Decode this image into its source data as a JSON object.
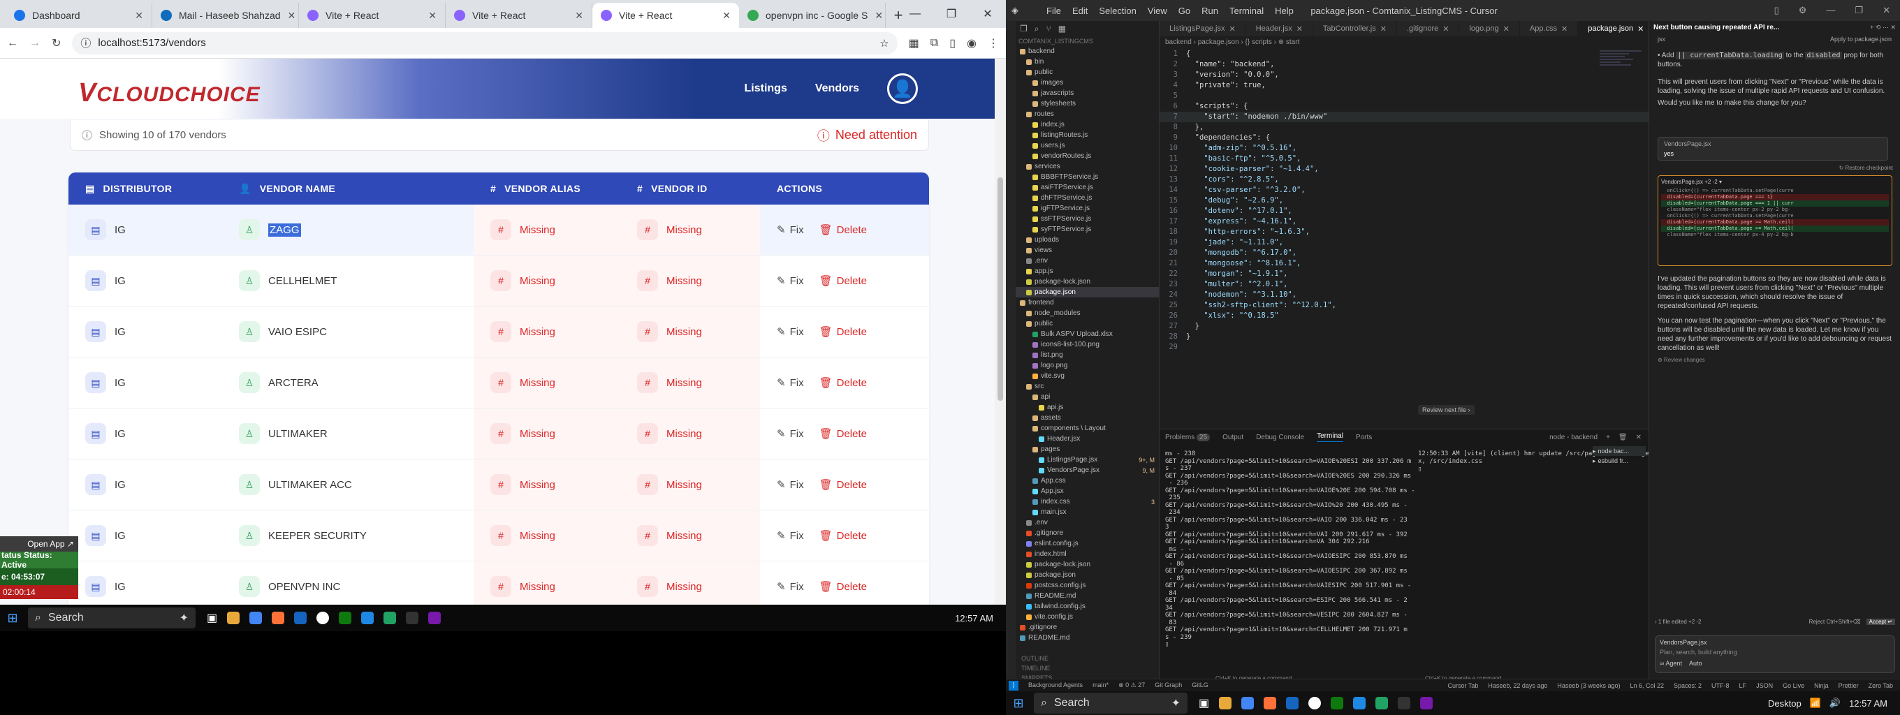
{
  "browser": {
    "tabs": [
      {
        "label": "Dashboard",
        "color": "#1a73e8"
      },
      {
        "label": "Mail - Haseeb Shahzad",
        "color": "#0f6cbd"
      },
      {
        "label": "Vite + React",
        "color": "#8a63ff"
      },
      {
        "label": "Vite + React",
        "color": "#8a63ff"
      },
      {
        "label": "Vite + React",
        "color": "#8a63ff",
        "active": true
      },
      {
        "label": "openvpn inc - Google S",
        "color": "#34a853"
      }
    ],
    "url": "localhost:5173/vendors"
  },
  "app": {
    "logo_v": "V",
    "logo_text": "CLOUDCHOICE",
    "nav": [
      "Listings",
      "Vendors"
    ],
    "summary": "Showing 10 of 170 vendors",
    "attention": "Need attention",
    "columns": [
      "DISTRIBUTOR",
      "VENDOR NAME",
      "VENDOR ALIAS",
      "VENDOR ID",
      "ACTIONS"
    ],
    "fix_label": "Fix",
    "delete_label": "Delete",
    "rows": [
      {
        "distributor": "IG",
        "name": "ZAGG",
        "alias": "Missing",
        "id": "Missing"
      },
      {
        "distributor": "IG",
        "name": "CELLHELMET",
        "alias": "Missing",
        "id": "Missing"
      },
      {
        "distributor": "IG",
        "name": "VAIO ESIPC",
        "alias": "Missing",
        "id": "Missing"
      },
      {
        "distributor": "IG",
        "name": "ARCTERA",
        "alias": "Missing",
        "id": "Missing"
      },
      {
        "distributor": "IG",
        "name": "ULTIMAKER",
        "alias": "Missing",
        "id": "Missing"
      },
      {
        "distributor": "IG",
        "name": "ULTIMAKER ACC",
        "alias": "Missing",
        "id": "Missing"
      },
      {
        "distributor": "IG",
        "name": "KEEPER SECURITY",
        "alias": "Missing",
        "id": "Missing"
      },
      {
        "distributor": "IG",
        "name": "OPENVPN INC",
        "alias": "Missing",
        "id": "Missing"
      }
    ]
  },
  "widget": {
    "open": "Open App ↗",
    "status": "tatus Status: Active",
    "time": "e: 04:53:07",
    "extra": "02:00:14"
  },
  "taskbar_left": {
    "search": "Search",
    "time": "12:57 AM"
  },
  "taskbar_right": {
    "search": "Search",
    "desktop": "Desktop",
    "time": "12:57 AM"
  },
  "vscode": {
    "menu": [
      "File",
      "Edit",
      "Selection",
      "View",
      "Go",
      "Run",
      "Terminal",
      "Help"
    ],
    "title": "package.json - Comtanix_ListingCMS - Cursor",
    "tabs": [
      "ListingsPage.jsx",
      "Header.jsx",
      "TabController.js",
      ".gitignore",
      "logo.png",
      "App.css",
      "package.json"
    ],
    "crumbs": "backend  ›  package.json  ›  {} scripts  ›  ⊕ start",
    "explorer_title": "COMTANIX_LISTINGCMS",
    "files": [
      {
        "name": "backend",
        "d": 0,
        "c": "#dcb67a"
      },
      {
        "name": "bin",
        "d": 1,
        "c": "#dcb67a"
      },
      {
        "name": "public",
        "d": 1,
        "c": "#dcb67a"
      },
      {
        "name": "images",
        "d": 2,
        "c": "#dcb67a"
      },
      {
        "name": "javascripts",
        "d": 2,
        "c": "#dcb67a"
      },
      {
        "name": "stylesheets",
        "d": 2,
        "c": "#dcb67a"
      },
      {
        "name": "routes",
        "d": 1,
        "c": "#dcb67a"
      },
      {
        "name": "index.js",
        "d": 2,
        "c": "#e8d44d"
      },
      {
        "name": "listingRoutes.js",
        "d": 2,
        "c": "#e8d44d"
      },
      {
        "name": "users.js",
        "d": 2,
        "c": "#e8d44d"
      },
      {
        "name": "vendorRoutes.js",
        "d": 2,
        "c": "#e8d44d"
      },
      {
        "name": "services",
        "d": 1,
        "c": "#dcb67a"
      },
      {
        "name": "BBBFTPService.js",
        "d": 2,
        "c": "#e8d44d"
      },
      {
        "name": "asiFTPService.js",
        "d": 2,
        "c": "#e8d44d"
      },
      {
        "name": "dhFTPService.js",
        "d": 2,
        "c": "#e8d44d"
      },
      {
        "name": "igFTPService.js",
        "d": 2,
        "c": "#e8d44d"
      },
      {
        "name": "ssFTPService.js",
        "d": 2,
        "c": "#e8d44d"
      },
      {
        "name": "syFTPService.js",
        "d": 2,
        "c": "#e8d44d"
      },
      {
        "name": "uploads",
        "d": 1,
        "c": "#dcb67a"
      },
      {
        "name": "views",
        "d": 1,
        "c": "#dcb67a"
      },
      {
        "name": ".env",
        "d": 1,
        "c": "#888"
      },
      {
        "name": "app.js",
        "d": 1,
        "c": "#e8d44d"
      },
      {
        "name": "package-lock.json",
        "d": 1,
        "c": "#cbcb41"
      },
      {
        "name": "package.json",
        "d": 1,
        "c": "#cbcb41",
        "sel": true
      },
      {
        "name": "frontend",
        "d": 0,
        "c": "#dcb67a"
      },
      {
        "name": "node_modules",
        "d": 1,
        "c": "#dcb67a"
      },
      {
        "name": "public",
        "d": 1,
        "c": "#dcb67a"
      },
      {
        "name": "Bulk ASPV Upload.xlsx",
        "d": 2,
        "c": "#21a366"
      },
      {
        "name": "icons8-list-100.png",
        "d": 2,
        "c": "#a074c4"
      },
      {
        "name": "list.png",
        "d": 2,
        "c": "#a074c4"
      },
      {
        "name": "logo.png",
        "d": 2,
        "c": "#a074c4"
      },
      {
        "name": "vite.svg",
        "d": 2,
        "c": "#ffb13b"
      },
      {
        "name": "src",
        "d": 1,
        "c": "#dcb67a"
      },
      {
        "name": "api",
        "d": 2,
        "c": "#dcb67a"
      },
      {
        "name": "api.js",
        "d": 3,
        "c": "#e8d44d"
      },
      {
        "name": "assets",
        "d": 2,
        "c": "#dcb67a"
      },
      {
        "name": "components \\ Layout",
        "d": 2,
        "c": "#dcb67a"
      },
      {
        "name": "Header.jsx",
        "d": 3,
        "c": "#61dafb"
      },
      {
        "name": "pages",
        "d": 2,
        "c": "#dcb67a"
      },
      {
        "name": "ListingsPage.jsx",
        "d": 3,
        "c": "#61dafb",
        "badge": "9+, M"
      },
      {
        "name": "VendorsPage.jsx",
        "d": 3,
        "c": "#61dafb",
        "badge": "9, M"
      },
      {
        "name": "App.css",
        "d": 2,
        "c": "#519aba"
      },
      {
        "name": "App.jsx",
        "d": 2,
        "c": "#61dafb"
      },
      {
        "name": "index.css",
        "d": 2,
        "c": "#519aba",
        "badge": "3"
      },
      {
        "name": "main.jsx",
        "d": 2,
        "c": "#61dafb"
      },
      {
        "name": ".env",
        "d": 1,
        "c": "#888"
      },
      {
        "name": ".gitignore",
        "d": 1,
        "c": "#e44d26"
      },
      {
        "name": "eslint.config.js",
        "d": 1,
        "c": "#8080f2"
      },
      {
        "name": "index.html",
        "d": 1,
        "c": "#e44d26"
      },
      {
        "name": "package-lock.json",
        "d": 1,
        "c": "#cbcb41"
      },
      {
        "name": "package.json",
        "d": 1,
        "c": "#cbcb41"
      },
      {
        "name": "postcss.config.js",
        "d": 1,
        "c": "#dd3a0a"
      },
      {
        "name": "README.md",
        "d": 1,
        "c": "#519aba"
      },
      {
        "name": "tailwind.config.js",
        "d": 1,
        "c": "#38bdf8"
      },
      {
        "name": "vite.config.js",
        "d": 1,
        "c": "#ffb13b"
      },
      {
        "name": ".gitignore",
        "d": 0,
        "c": "#e44d26"
      },
      {
        "name": "README.md",
        "d": 0,
        "c": "#519aba"
      }
    ],
    "outline": [
      "OUTLINE",
      "TIMELINE",
      "SNIPPETS"
    ],
    "code": [
      "{",
      "  \"name\": \"backend\",",
      "  \"version\": \"0.0.0\",",
      "  \"private\": true,",
      "  ",
      "  \"scripts\": {",
      "    \"start\": \"nodemon ./bin/www\"",
      "  },",
      "  \"dependencies\": {",
      "    \"adm-zip\": \"^0.5.16\",",
      "    \"basic-ftp\": \"^5.0.5\",",
      "    \"cookie-parser\": \"~1.4.4\",",
      "    \"cors\": \"^2.8.5\",",
      "    \"csv-parser\": \"^3.2.0\",",
      "    \"debug\": \"~2.6.9\",",
      "    \"dotenv\": \"^17.0.1\",",
      "    \"express\": \"~4.16.1\",",
      "    \"http-errors\": \"~1.6.3\",",
      "    \"jade\": \"~1.11.0\",",
      "    \"mongodb\": \"^6.17.0\",",
      "    \"mongoose\": \"^8.16.1\",",
      "    \"morgan\": \"~1.9.1\",",
      "    \"multer\": \"^2.0.1\",",
      "    \"nodemon\": \"^3.1.10\",",
      "    \"ssh2-sftp-client\": \"^12.0.1\",",
      "    \"xlsx\": \"^0.18.5\"",
      "  }",
      "}",
      ""
    ],
    "review_btn": "Review next file ›",
    "panel_tabs": [
      "Problems",
      "Output",
      "Debug Console",
      "Terminal",
      "Ports"
    ],
    "problems_count": "25",
    "term_name": "node - backend",
    "terminal": [
      "ms - 238",
      "GET /api/vendors?page=5&limit=10&search=VAIOE%20ESI 200 337.206 m",
      "s - 237",
      "GET /api/vendors?page=5&limit=10&search=VAIOE%20ES 200 290.326 ms",
      " - 236",
      "GET /api/vendors?page=5&limit=10&search=VAIOE%20E 200 594.708 ms -",
      " 235",
      "GET /api/vendors?page=5&limit=10&search=VAIO%20 200 430.495 ms -",
      " 234",
      "GET /api/vendors?page=5&limit=10&search=VAIO 200 336.042 ms - 23",
      "3",
      "GET /api/vendors?page=5&limit=10&search=VAI 200 291.617 ms - 392",
      "GET /api/vendors?page=5&limit=10&search=VA 304 292.216",
      " ms - -",
      "GET /api/vendors?page=5&limit=10&search=VAIOESIPC 200 853.870 ms",
      " - 86",
      "GET /api/vendors?page=5&limit=10&search=VAIOESIPC 200 367.892 ms",
      " - 85",
      "GET /api/vendors?page=5&limit=10&search=VAIESIPC 200 517.901 ms -",
      " 84",
      "GET /api/vendors?page=5&limit=10&search=ESIPC 200 566.541 ms - 2",
      "34",
      "GET /api/vendors?page=5&limit=10&search=VESIPC 200 2604.827 ms -",
      " 83",
      "GET /api/vendors?page=1&limit=10&search=CELLHELMET 200 721.971 m",
      "s - 239",
      "▯"
    ],
    "terminal2": [
      "12:50:33 AM [vite] (client) hmr update /src/pages/VendorsPage.js",
      "x, /src/index.css",
      "▯"
    ],
    "term_list": [
      "node bac...",
      "esbuild fr..."
    ],
    "hint_left": "Ctrl+K to generate a command",
    "hint_right": "Ctrl+K to generate a command",
    "status_left": [
      "Background Agents",
      "main*",
      "⊗ 0 ⚠ 27",
      "Git Graph",
      "GitLG"
    ],
    "status_right": [
      "Cursor Tab",
      "Haseeb, 22 days ago",
      "Haseeb (3 weeks ago)",
      "Ln 6, Col 22",
      "Spaces: 2",
      "UTF-8",
      "LF",
      "JSON",
      "Go Live",
      "Ninja",
      "Prettier",
      "Zero Tab"
    ],
    "chat": {
      "title": "Next button causing repeated API re...",
      "apply": "Apply to package.json",
      "file1": "jsx",
      "bullet_a": "Add ",
      "bullet_code": "|| currentTabData.loading",
      "bullet_b": " to the ",
      "bullet_code2": "disabled",
      "bullet_c": " prop for both buttons.",
      "p1": "This will prevent users from clicking \"Next\" or \"Previous\" while the data is loading, solving the issue of multiple rapid API requests and UI confusion.",
      "p2": "Would you like me to make this change for you?",
      "chip1_file": "VendorsPage.jsx",
      "chip1_text": "yes",
      "restore": "↻ Restore checkpoint",
      "diff_file": "VendorsPage.jsx +2 -2 ▾",
      "diff": [
        {
          "k": "ctx",
          "t": "  onClick={() => currentTabData.setPage(curre"
        },
        {
          "k": "del",
          "t": "  disabled={currentTabData.page === 1}"
        },
        {
          "k": "add",
          "t": "  disabled={currentTabData.page === 1 || curr"
        },
        {
          "k": "ctx",
          "t": "  className=\"flex items-center px-2 py-2 bg-"
        },
        {
          "k": "ctx",
          "t": ""
        },
        {
          "k": "ctx",
          "t": "  onClick={() => currentTabData.setPage(curre"
        },
        {
          "k": "del",
          "t": "  disabled={currentTabData.page >= Math.ceil("
        },
        {
          "k": "add",
          "t": "  disabled={currentTabData.page >= Math.ceil("
        },
        {
          "k": "ctx",
          "t": "  className=\"flex items-center px-4 py-2 bg-b"
        }
      ],
      "p3": "I've updated the pagination buttons so they are now disabled while data is loading. This will prevent users from clicking \"Next\" or \"Previous\" multiple times in quick succession, which should resolve the issue of repeated/confused API requests.",
      "p4": "You can now test the pagination—when you click \"Next\" or \"Previous,\" the buttons will be disabled until the new data is loaded. Let me know if you need any further improvements or if you'd like to add debouncing or request cancellation as well!",
      "review_changes": "⊕ Review changes",
      "files_edited": "› 1 file edited +2 -2",
      "reject": "Reject Ctrl+Shift+⌫",
      "accept": "Accept ↵",
      "input_file": "VendorsPage.jsx",
      "placeholder": "Plan, search, build anything",
      "agent": "∞ Agent",
      "auto": "Auto"
    }
  }
}
